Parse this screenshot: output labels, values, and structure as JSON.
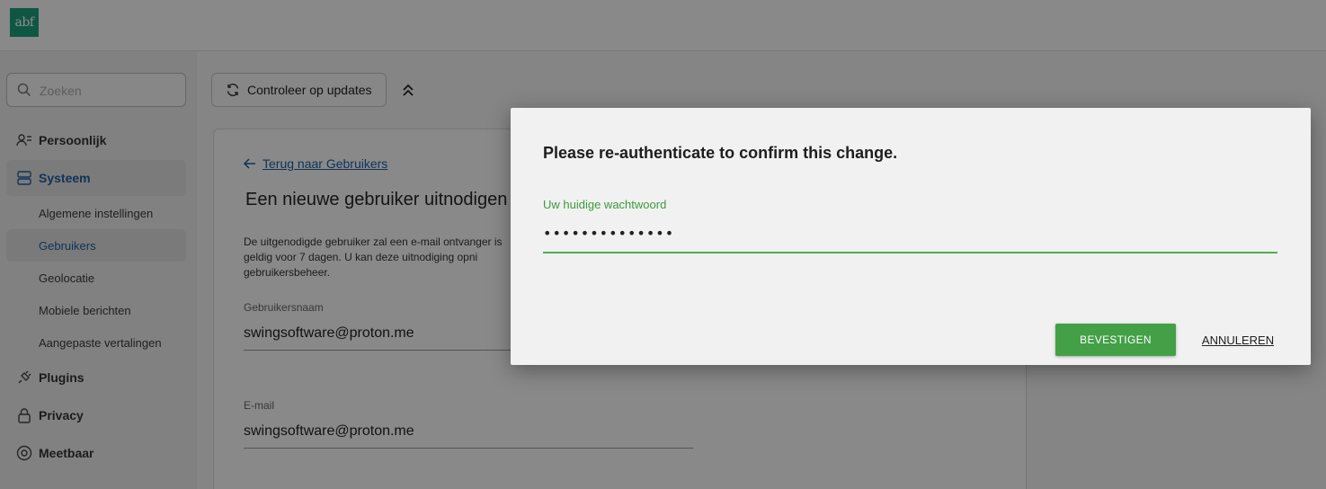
{
  "app": {
    "logo_text": "abf",
    "brand_color": "#1d9e7a",
    "link_color": "#1d5fa3"
  },
  "sidebar": {
    "search": {
      "placeholder": "Zoeken",
      "icon": "search-icon"
    },
    "items": [
      {
        "label": "Persoonlijk",
        "icon": "user-list-icon"
      },
      {
        "label": "Systeem",
        "icon": "server-icon",
        "active": true
      },
      {
        "label": "Algemene instellingen"
      },
      {
        "label": "Gebruikers",
        "active": true
      },
      {
        "label": "Geolocatie"
      },
      {
        "label": "Mobiele berichten"
      },
      {
        "label": "Aangepaste vertalingen"
      },
      {
        "label": "Plugins",
        "icon": "plug-icon"
      },
      {
        "label": "Privacy",
        "icon": "lock-icon"
      },
      {
        "label": "Meetbaar",
        "icon": "gauge-icon"
      }
    ]
  },
  "toolbar": {
    "update_label": "Controleer op updates",
    "update_icon": "refresh-icon",
    "collapse_icon": "double-chevron-up-icon"
  },
  "card": {
    "back_label": "Terug naar Gebruikers",
    "title": "Een nieuwe gebruiker uitnodigen",
    "description": "De uitgenodigde gebruiker zal een e-mail ontvanger is geldig voor 7 dagen. U kan deze uitnodiging opni gebruikersbeheer.",
    "username_label": "Gebruikersnaam",
    "username_value": "swingsoftware@proton.me",
    "email_label": "E-mail",
    "email_value": "swingsoftware@proton.me"
  },
  "dialog": {
    "title": "Please re-authenticate to confirm this change.",
    "password_label": "Uw huidige wachtwoord",
    "password_value": "••••••••••••••",
    "confirm_label": "BEVESTIGEN",
    "cancel_label": "ANNULEREN",
    "accent_color": "#43a047"
  }
}
